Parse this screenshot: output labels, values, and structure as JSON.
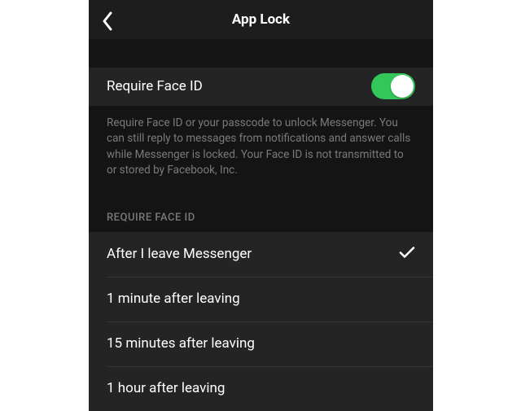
{
  "nav": {
    "title": "App Lock"
  },
  "toggle": {
    "label": "Require Face ID",
    "on": true
  },
  "description": "Require Face ID or your passcode to unlock Messenger. You can still reply to messages from notifications and answer calls while Messenger is locked. Your Face ID is not transmitted to or stored by Facebook, Inc.",
  "section_header": "REQUIRE FACE ID",
  "options": [
    {
      "label": "After I leave Messenger",
      "selected": true
    },
    {
      "label": "1 minute after leaving",
      "selected": false
    },
    {
      "label": "15 minutes after leaving",
      "selected": false
    },
    {
      "label": "1 hour after leaving",
      "selected": false
    }
  ],
  "colors": {
    "toggle_on": "#33c759",
    "background_dark": "#141414",
    "row_dark": "#242424"
  }
}
